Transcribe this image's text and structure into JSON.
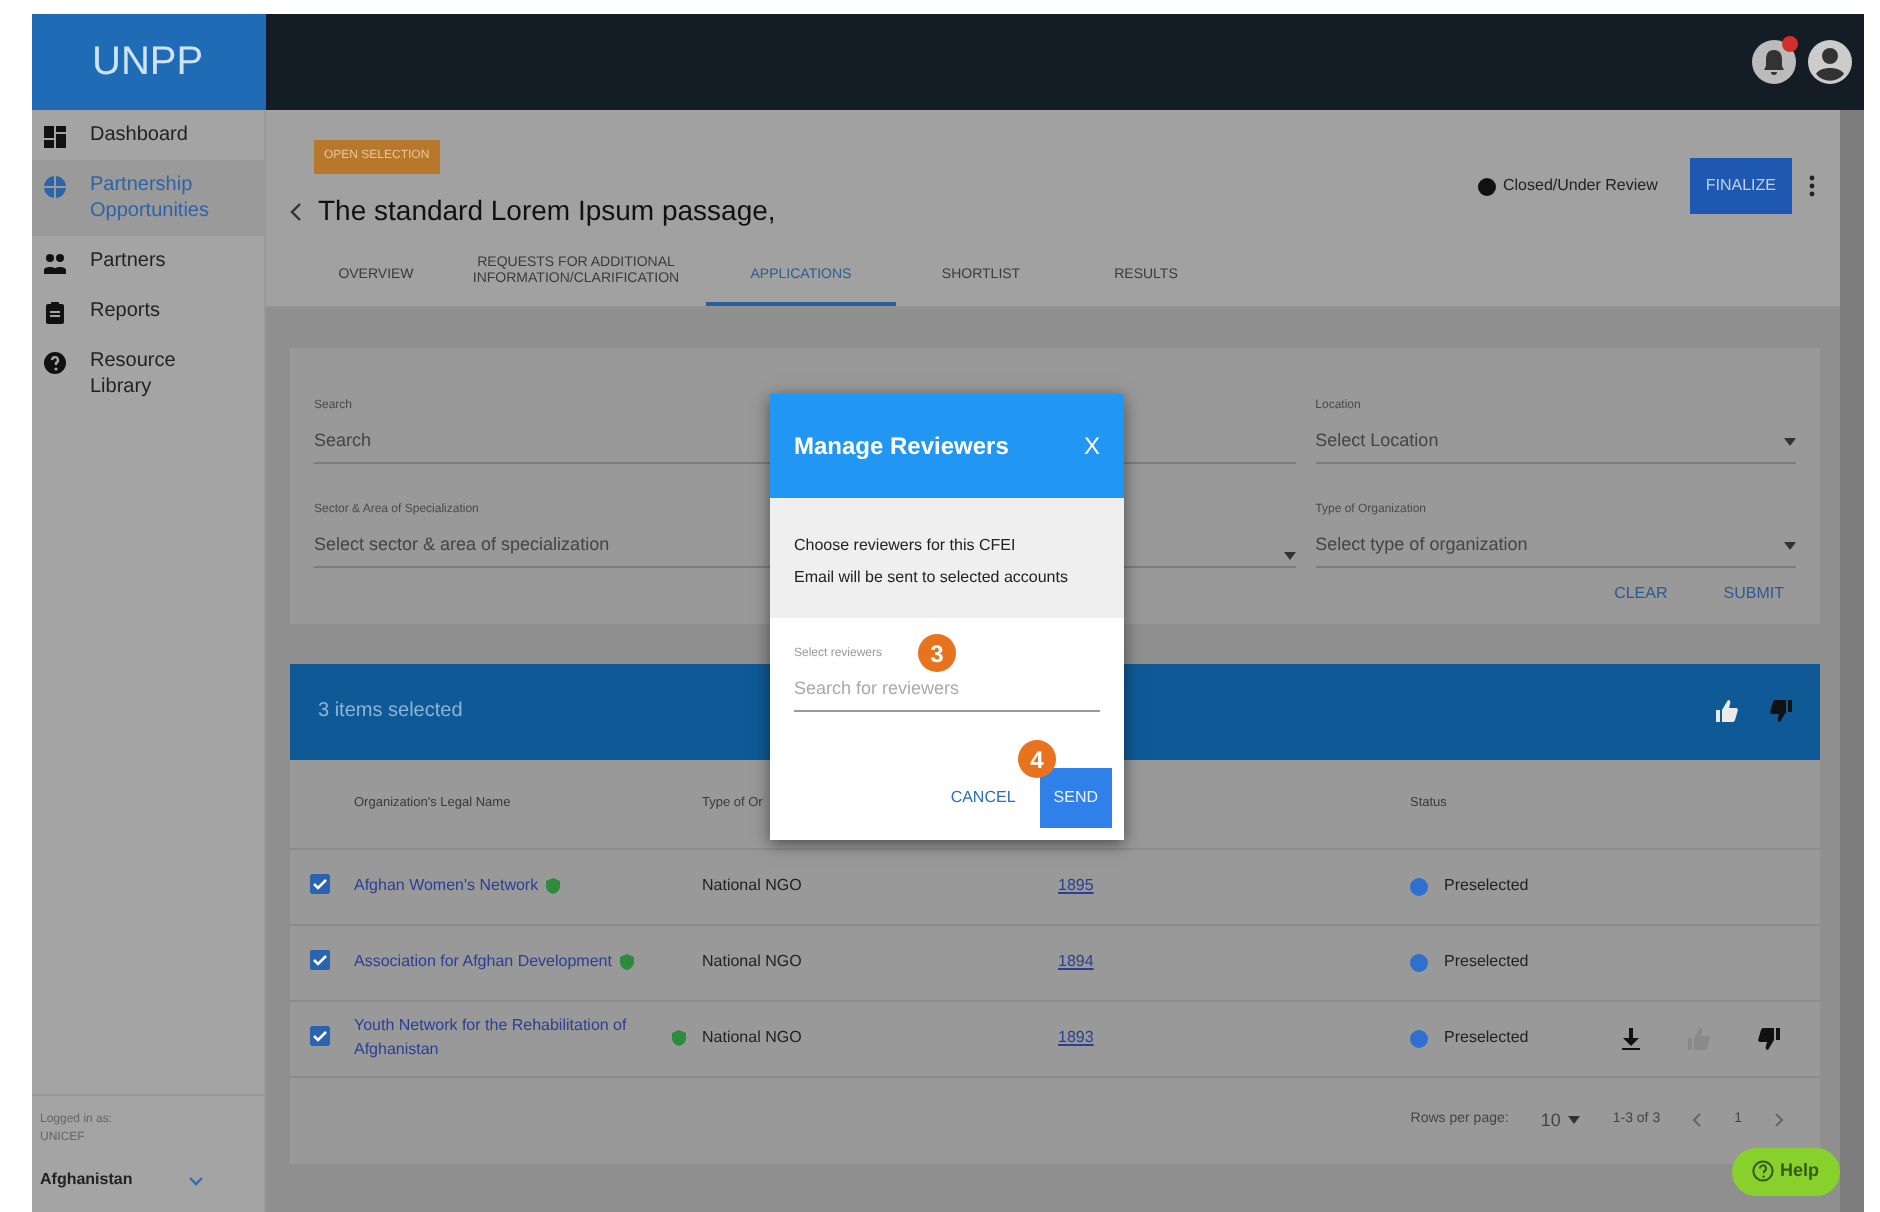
{
  "header": {
    "logo": "UNPP"
  },
  "sidebar": {
    "items": [
      {
        "label": "Dashboard",
        "selected": false
      },
      {
        "label": "Partnership Opportunities",
        "selected": true
      },
      {
        "label": "Partners",
        "selected": false
      },
      {
        "label": "Reports",
        "selected": false
      },
      {
        "label": "Resource Library",
        "selected": false
      }
    ],
    "logged_in_label": "Logged in as:",
    "account": "UNICEF",
    "country": "Afghanistan"
  },
  "page": {
    "tag": "OPEN SELECTION",
    "title": "The standard Lorem Ipsum passage,",
    "status": "Closed/Under Review",
    "finalize": "FINALIZE",
    "tabs": [
      {
        "label": "OVERVIEW",
        "selected": false
      },
      {
        "label": "REQUESTS FOR ADDITIONAL INFORMATION/CLARIFICATION",
        "selected": false
      },
      {
        "label": "APPLICATIONS",
        "selected": true
      },
      {
        "label": "SHORTLIST",
        "selected": false
      },
      {
        "label": "RESULTS",
        "selected": false
      }
    ]
  },
  "filters": {
    "fields": [
      {
        "label": "Search",
        "placeholder": "Search",
        "kind": "text"
      },
      {
        "kind": "hidden"
      },
      {
        "label": "Location",
        "placeholder": "Select Location",
        "kind": "select"
      },
      {
        "label": "Sector & Area of Specialization",
        "placeholder": "Select sector & area of specialization",
        "kind": "text"
      },
      {
        "kind": "hidden-select"
      },
      {
        "label": "Type of Organization",
        "placeholder": "Select type of organization",
        "kind": "select"
      }
    ],
    "buttons": [
      "CLEAR",
      "SUBMIT"
    ]
  },
  "table": {
    "selection_text": "3 items selected",
    "columns": [
      "Organization's Legal Name",
      "Type of Or",
      "Status"
    ],
    "rows": [
      {
        "checked": true,
        "name": "Afghan Women's Network",
        "verified": true,
        "type": "National NGO",
        "id": "1895",
        "status": "Preselected",
        "actions": false
      },
      {
        "checked": true,
        "name": "Association for Afghan Development",
        "verified": true,
        "type": "National NGO",
        "id": "1894",
        "status": "Preselected",
        "actions": false
      },
      {
        "checked": true,
        "name": "Youth Network for the Rehabilitation of Afghanistan",
        "verified": true,
        "type": "National NGO",
        "id": "1893",
        "status": "Preselected",
        "actions": true
      }
    ],
    "rows_per_page_label": "Rows per page:",
    "rows_per_page": "10",
    "range": "1-3 of 3",
    "page": "1"
  },
  "modal": {
    "title": "Manage Reviewers",
    "close": "X",
    "lines": [
      "Choose reviewers for this CFEI",
      "Email will be sent to selected accounts"
    ],
    "field_label": "Select reviewers",
    "placeholder": "Search for reviewers",
    "cancel": "CANCEL",
    "send": "SEND"
  },
  "steps": [
    "3",
    "4"
  ],
  "help": "Help"
}
